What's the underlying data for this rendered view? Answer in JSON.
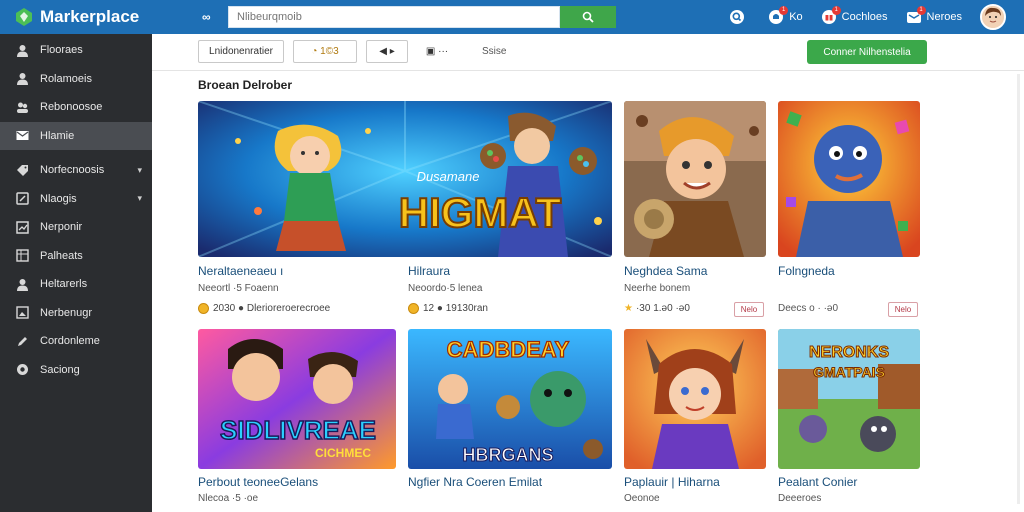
{
  "header": {
    "app_name": "Markerplace",
    "glasses_label": "∞",
    "search_placeholder": "Nlibeurqmoib",
    "right_items": [
      {
        "label": "Ko",
        "icon": "notification-icon",
        "badge": "1"
      },
      {
        "label": "Cochloes",
        "icon": "gift-icon",
        "badge": "1"
      },
      {
        "label": "Neroes",
        "icon": "inbox-icon",
        "badge": "1"
      }
    ]
  },
  "sidebar": {
    "items": [
      {
        "label": "Flooraes",
        "icon": "person-icon"
      },
      {
        "label": "Rolamoeis",
        "icon": "person-icon"
      },
      {
        "label": "Rebonoosoe",
        "icon": "group-icon"
      },
      {
        "label": "Hlamie",
        "icon": "mail-icon",
        "active": true
      },
      {
        "label": "Norfecnoosis",
        "icon": "tag-icon",
        "chevron": true
      },
      {
        "label": "Nlaogis",
        "icon": "edit-icon",
        "chevron": true
      },
      {
        "label": "Nerponir",
        "icon": "chart-icon"
      },
      {
        "label": "Palheats",
        "icon": "table-icon"
      },
      {
        "label": "Heltarerls",
        "icon": "person-icon"
      },
      {
        "label": "Nerbenugr",
        "icon": "image-icon"
      },
      {
        "label": "Cordonleme",
        "icon": "pen-icon"
      },
      {
        "label": "Saciong",
        "icon": "settings-icon"
      }
    ]
  },
  "toolbar": {
    "filter1": "Lnidonenratier",
    "filter2": "◔ 1©3",
    "filter3": "◀ ▸",
    "filter4": "▣ ···",
    "filter5": "Ssise",
    "cta_label": "Conner Nilhenstelia"
  },
  "section": {
    "title": "Broean Delrober"
  },
  "cards": [
    {
      "title": "Neraltaeneaeu ı",
      "sub": "Neeortl ·5 Foaenn",
      "meta": "2030 ● Dlerioreroerecroee",
      "banner": "HIGMAT",
      "banner_sub": "Dusamane"
    },
    {
      "title": "Hilraura",
      "sub": "Neoordo·5 lenea",
      "meta": "12 ● 19130ran",
      "banner": ""
    },
    {
      "title": "Neghdea Sama",
      "sub": "Neerhe bonem",
      "meta": "·30 1.ǝ0 ·ǝ0",
      "tag": "Nelo",
      "banner": ""
    },
    {
      "title": "Folngneda",
      "sub": "",
      "meta": "Deecs o · ·ǝ0",
      "tag": "Nelo",
      "banner": ""
    },
    {
      "title": "Perbout teoneeGelans",
      "sub": "Nlecoa ·5 ·oe",
      "meta": "",
      "banner": "SIDLIVREAE",
      "banner_sub": "CICHMEC"
    },
    {
      "title": "Ngfier Nra Coeren Emilat",
      "sub": "",
      "meta": "",
      "banner": "HBRGANS",
      "banner_sub": "CADBDEAY"
    },
    {
      "title": "Paplauir | Hiharna",
      "sub": "Oeonoe",
      "meta": "",
      "banner": ""
    },
    {
      "title": "Pealant Conier",
      "sub": "Deeeroes",
      "meta": "",
      "banner": "NERONKS",
      "banner_sub": "GMATPAIS"
    }
  ],
  "colors": {
    "topbar": "#1e6fb5",
    "sidebar": "#2b2d30",
    "accent_green": "#3ba84a",
    "title_blue": "#1a4f7a"
  }
}
